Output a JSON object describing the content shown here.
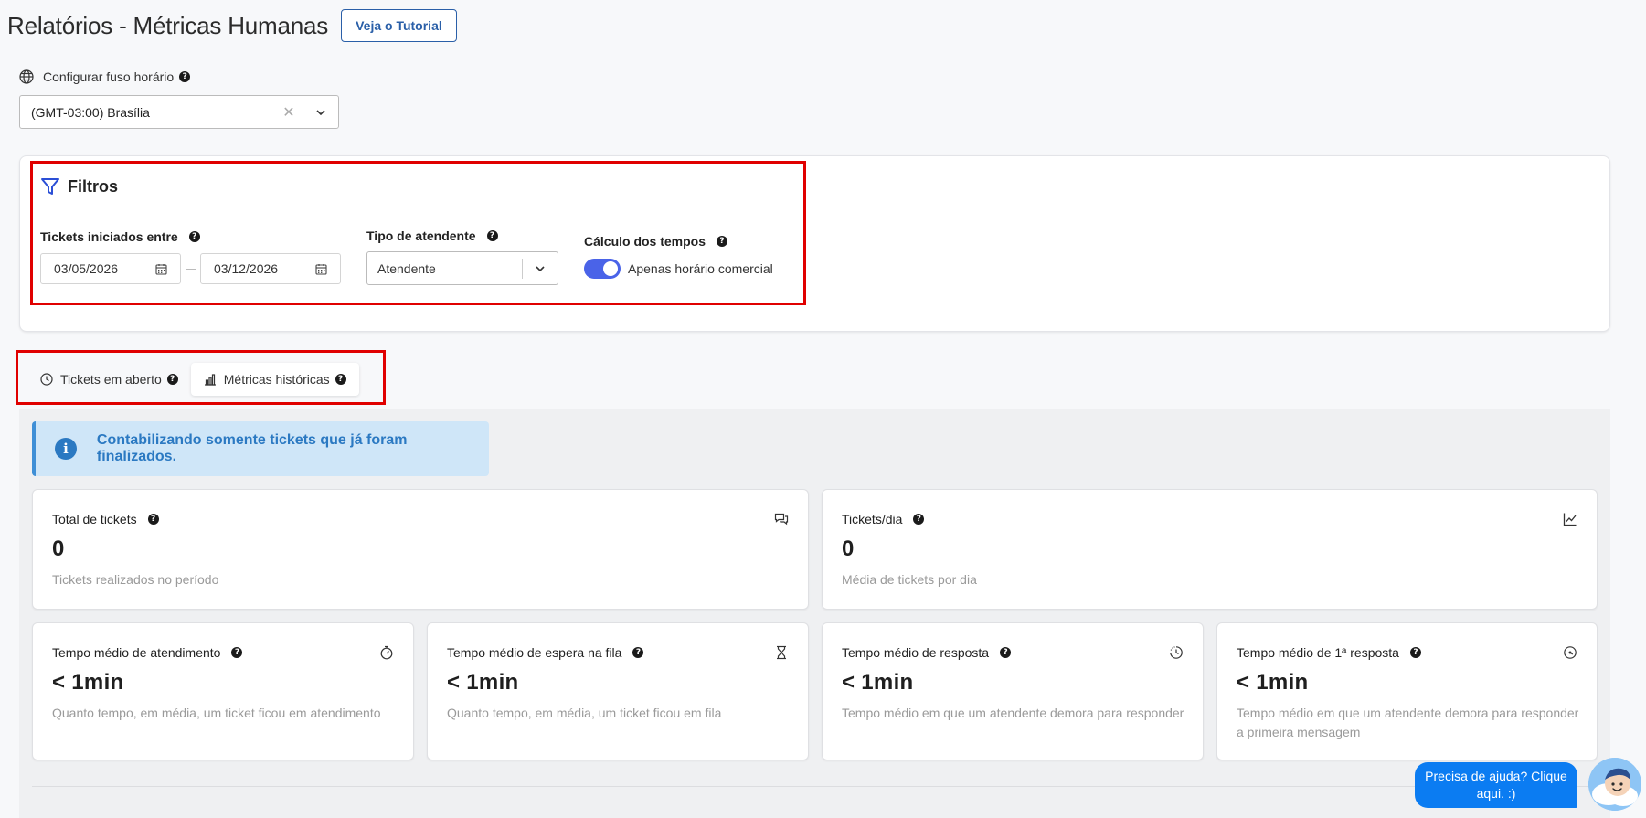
{
  "header": {
    "title": "Relatórios - Métricas Humanas",
    "tutorial_label": "Veja o Tutorial"
  },
  "timezone": {
    "label": "Configurar fuso horário",
    "value": "(GMT-03:00) Brasília"
  },
  "filters": {
    "title": "Filtros",
    "date_range_label": "Tickets iniciados entre",
    "start_date": "03/05/2026",
    "end_date": "03/12/2026",
    "agent_type_label": "Tipo de atendente",
    "agent_type_value": "Atendente",
    "time_calc_label": "Cálculo dos tempos",
    "time_calc_toggle_label": "Apenas horário comercial",
    "time_calc_enabled": true
  },
  "tabs": [
    {
      "label": "Tickets em aberto",
      "icon": "clock-icon",
      "active": false
    },
    {
      "label": "Métricas históricas",
      "icon": "bar-chart-icon",
      "active": true
    }
  ],
  "info": {
    "text": "Contabilizando somente tickets que já foram finalizados."
  },
  "metrics": {
    "total_tickets": {
      "title": "Total de tickets",
      "value": "0",
      "desc": "Tickets realizados no período",
      "icon": "chat-icon"
    },
    "tickets_day": {
      "title": "Tickets/dia",
      "value": "0",
      "desc": "Média de tickets por dia",
      "icon": "trend-line-icon"
    },
    "avg_service": {
      "title": "Tempo médio de atendimento",
      "value": "< 1min",
      "desc": "Quanto tempo, em média, um ticket ficou em atendimento",
      "icon": "stopwatch-icon"
    },
    "avg_queue": {
      "title": "Tempo médio de espera na fila",
      "value": "< 1min",
      "desc": "Quanto tempo, em média, um ticket ficou em fila",
      "icon": "hourglass-icon"
    },
    "avg_response": {
      "title": "Tempo médio de resposta",
      "value": "< 1min",
      "desc": "Tempo médio em que um atendente demora para responder",
      "icon": "clock-dashed-icon"
    },
    "avg_first_response": {
      "title": "Tempo médio de 1ª resposta",
      "value": "< 1min",
      "desc": "Tempo médio em que um atendente demora para responder a primeira mensagem",
      "icon": "clock-arrow-icon"
    }
  },
  "help_widget": {
    "text": "Precisa de ajuda? Clique aqui. :)"
  },
  "colors": {
    "accent": "#4a63e8",
    "info_bg": "#cfe6f8",
    "info_text": "#2b79c2",
    "highlight_border": "#e00000",
    "help_bubble": "#0b7cf2"
  }
}
